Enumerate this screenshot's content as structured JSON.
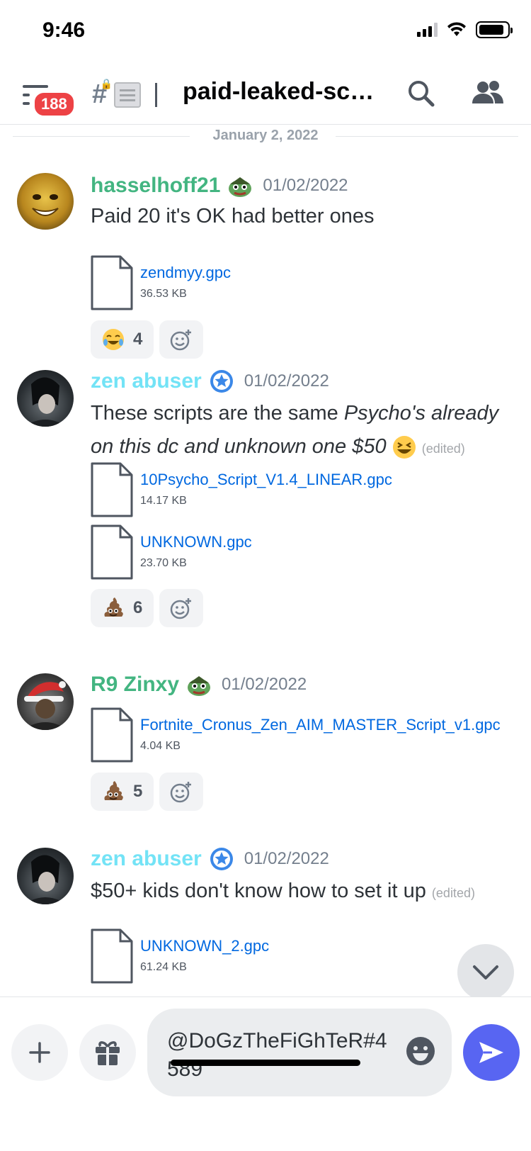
{
  "status_bar": {
    "time": "9:46"
  },
  "header": {
    "unread_count": "188",
    "channel_name": "paid-leaked-sc…"
  },
  "date_divider": "January 2, 2022",
  "messages": [
    {
      "username": "hasselhoff21",
      "username_color": "#43b581",
      "timestamp": "01/02/2022",
      "text": "Paid 20  it's OK  had better ones",
      "attachments": [
        {
          "name": "zendmyy.gpc",
          "size": "36.53 KB"
        }
      ],
      "reactions": [
        {
          "emoji": "joy-emoji",
          "count": "4"
        }
      ]
    },
    {
      "username": "zen abuser",
      "username_color": "#73e3f6",
      "timestamp": "01/02/2022",
      "text_plain": "These scripts are the same ",
      "text_italic": "Psycho's already on this dc and unknown one $50",
      "edited": "(edited)",
      "attachments": [
        {
          "name": "10Psycho_Script_V1.4_LINEAR.gpc",
          "size": "14.17 KB"
        },
        {
          "name": "UNKNOWN.gpc",
          "size": "23.70 KB"
        }
      ],
      "reactions": [
        {
          "emoji": "poop-emoji",
          "count": "6"
        }
      ]
    },
    {
      "username": "R9 Zinxy",
      "username_color": "#43b581",
      "timestamp": "01/02/2022",
      "attachments": [
        {
          "name": "Fortnite_Cronus_Zen_AIM_MASTER_Script_v1.gpc",
          "size": "4.04 KB"
        }
      ],
      "reactions": [
        {
          "emoji": "poop-emoji",
          "count": "5"
        }
      ]
    },
    {
      "username": "zen abuser",
      "username_color": "#73e3f6",
      "timestamp": "01/02/2022",
      "text": "$50+ kids don't know how to set it up",
      "edited": "(edited)",
      "attachments": [
        {
          "name": "UNKNOWN_2.gpc",
          "size": "61.24 KB"
        }
      ]
    }
  ],
  "composer": {
    "input_value": "@DoGzTheFiGhTeR#4589"
  },
  "colors": {
    "accent": "#5865f2",
    "link": "#0068e0",
    "badge_red": "#ed4245"
  }
}
